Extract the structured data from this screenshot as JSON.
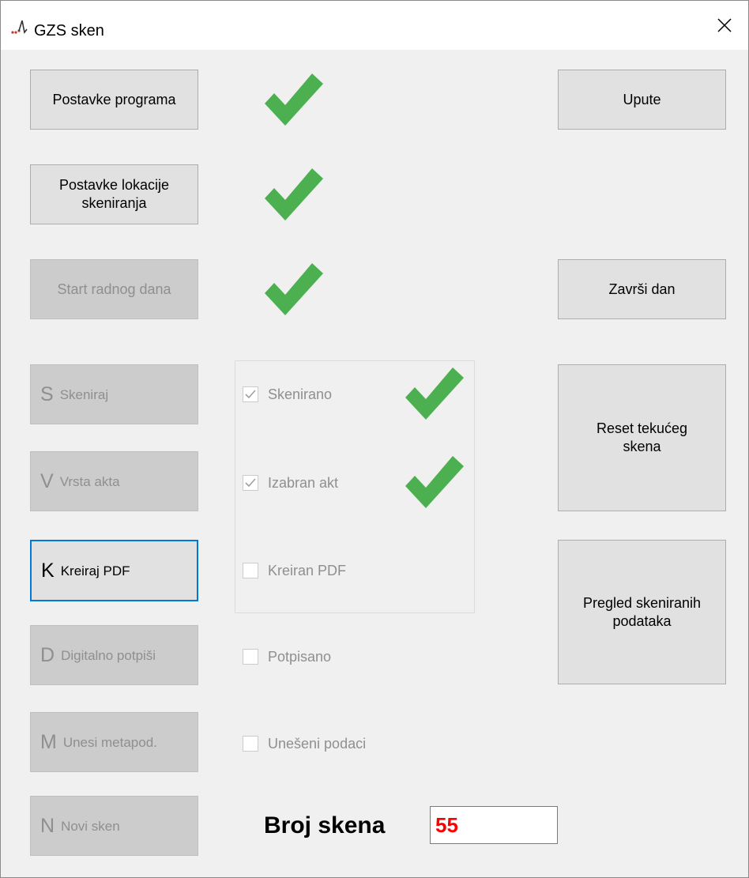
{
  "window": {
    "title": "GZS sken"
  },
  "buttons": {
    "program_settings": "Postavke programa",
    "scan_location_settings": "Postavke lokacije skeniranja",
    "start_workday": "Start radnog dana",
    "help": "Upute",
    "end_day": "Završi dan",
    "reset_scan": "Reset tekućeg skena",
    "review_scans": "Pregled skeniranih podataka"
  },
  "steps": [
    {
      "key": "S",
      "label": "Skeniraj",
      "enabled": false
    },
    {
      "key": "V",
      "label": "Vrsta akta",
      "enabled": false
    },
    {
      "key": "K",
      "label": "Kreiraj PDF",
      "enabled": true,
      "focused": true
    },
    {
      "key": "D",
      "label": "Digitalno potpiši",
      "enabled": false
    },
    {
      "key": "M",
      "label": "Unesi metapod.",
      "enabled": false
    },
    {
      "key": "N",
      "label": "Novi sken",
      "enabled": false
    }
  ],
  "status_checks": [
    {
      "label": "Skenirano",
      "checked": true,
      "confirmed": true
    },
    {
      "label": "Izabran akt",
      "checked": true,
      "confirmed": true
    },
    {
      "label": "Kreiran PDF",
      "checked": false,
      "confirmed": false
    },
    {
      "label": "Potpisano",
      "checked": false,
      "confirmed": false
    },
    {
      "label": "Unešeni podaci",
      "checked": false,
      "confirmed": false
    }
  ],
  "scan_count": {
    "label": "Broj skena",
    "value": "55"
  },
  "colors": {
    "check_green": "#4caf50",
    "count_red": "#ff0000",
    "focus_blue": "#0078d7"
  }
}
